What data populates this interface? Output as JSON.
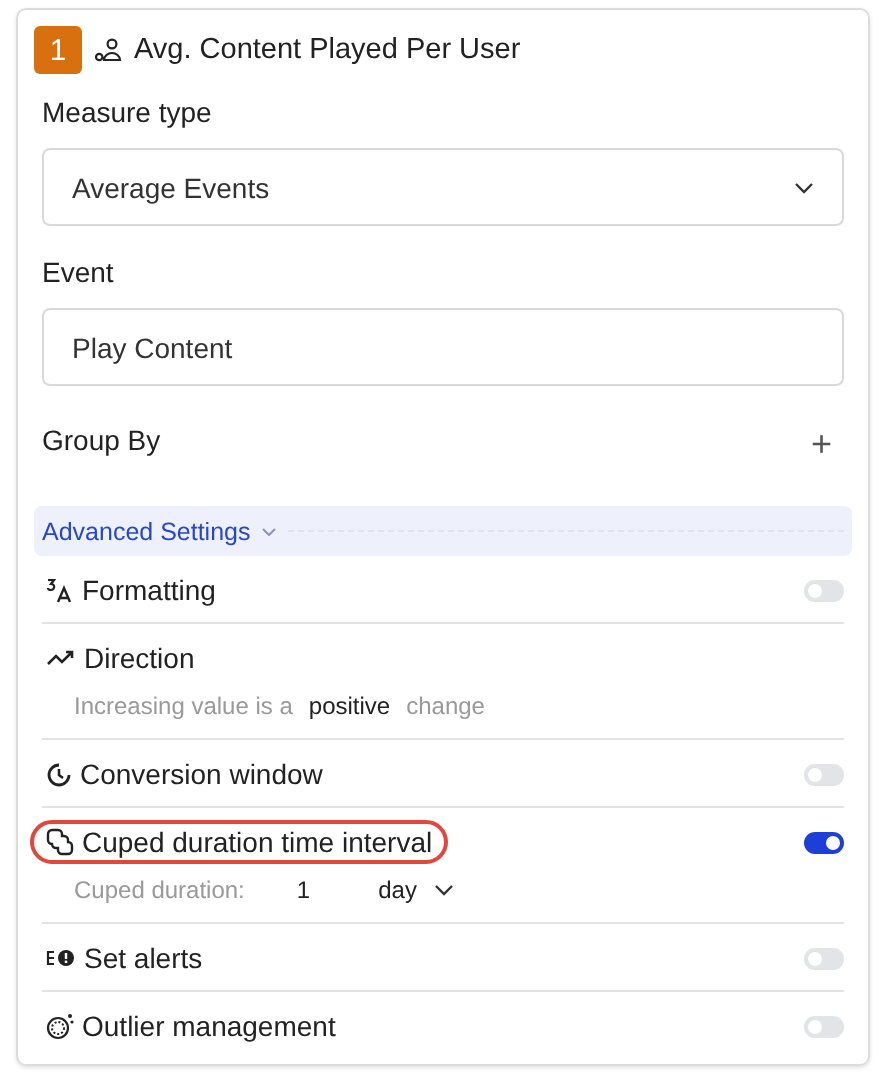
{
  "metric": {
    "number": "1",
    "title": "Avg. Content Played Per User"
  },
  "measure_type": {
    "label": "Measure type",
    "value": "Average Events"
  },
  "event": {
    "label": "Event",
    "value": "Play Content"
  },
  "group_by": {
    "label": "Group By",
    "add": "+"
  },
  "advanced": {
    "label": "Advanced Settings",
    "expanded": true
  },
  "settings": [
    {
      "kind": "toggle",
      "label": "Formatting",
      "on": false,
      "highlighted": false
    },
    {
      "kind": "direction",
      "label": "Direction",
      "highlighted": false,
      "description": {
        "start": "Increasing value is a",
        "choice": "positive",
        "end": "change"
      }
    },
    {
      "kind": "toggle",
      "label": "Conversion window",
      "on": false,
      "highlighted": false
    },
    {
      "kind": "toggle",
      "label": "Cuped duration time interval",
      "on": true,
      "highlighted": true,
      "detail": {
        "label": "Cuped duration:",
        "amount": "1",
        "unit": "day"
      }
    },
    {
      "kind": "toggle",
      "label": "Set alerts",
      "on": false,
      "highlighted": false
    },
    {
      "kind": "toggle",
      "label": "Outlier management",
      "on": false,
      "highlighted": false
    }
  ]
}
